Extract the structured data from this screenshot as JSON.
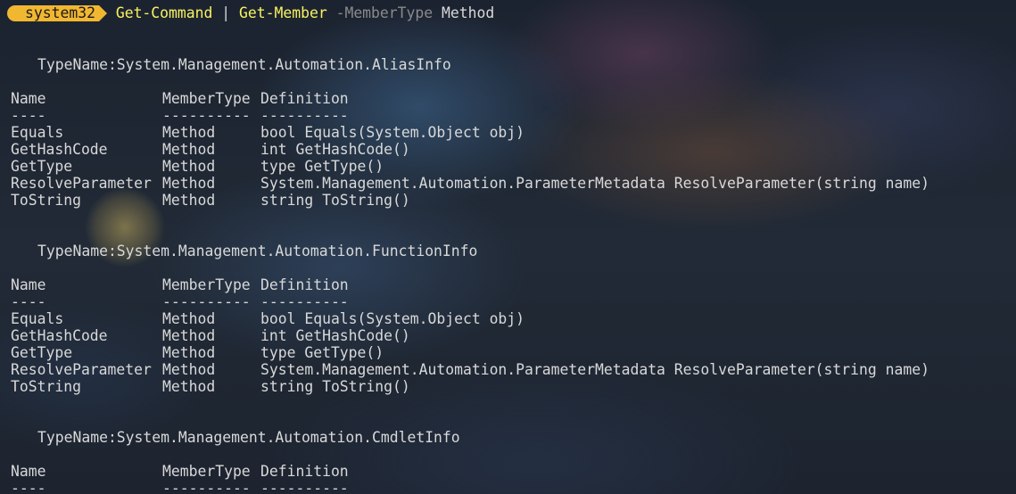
{
  "prompt": {
    "directory": "system32",
    "command1": "Get-Command",
    "pipe": "|",
    "command2": "Get-Member",
    "parameter": "-MemberType",
    "argument": "Method"
  },
  "columns": {
    "name": "Name",
    "member_type": "MemberType",
    "definition": "Definition",
    "dash_name": "----",
    "dash_member_type": "----------",
    "dash_definition": "----------"
  },
  "sections": [
    {
      "typename": "TypeName:System.Management.Automation.AliasInfo",
      "rows": [
        {
          "name": "Equals",
          "member_type": "Method",
          "definition": "bool Equals(System.Object obj)"
        },
        {
          "name": "GetHashCode",
          "member_type": "Method",
          "definition": "int GetHashCode()"
        },
        {
          "name": "GetType",
          "member_type": "Method",
          "definition": "type GetType()"
        },
        {
          "name": "ResolveParameter",
          "member_type": "Method",
          "definition": "System.Management.Automation.ParameterMetadata ResolveParameter(string name)"
        },
        {
          "name": "ToString",
          "member_type": "Method",
          "definition": "string ToString()"
        }
      ]
    },
    {
      "typename": "TypeName:System.Management.Automation.FunctionInfo",
      "rows": [
        {
          "name": "Equals",
          "member_type": "Method",
          "definition": "bool Equals(System.Object obj)"
        },
        {
          "name": "GetHashCode",
          "member_type": "Method",
          "definition": "int GetHashCode()"
        },
        {
          "name": "GetType",
          "member_type": "Method",
          "definition": "type GetType()"
        },
        {
          "name": "ResolveParameter",
          "member_type": "Method",
          "definition": "System.Management.Automation.ParameterMetadata ResolveParameter(string name)"
        },
        {
          "name": "ToString",
          "member_type": "Method",
          "definition": "string ToString()"
        }
      ]
    },
    {
      "typename": "TypeName:System.Management.Automation.CmdletInfo",
      "rows": []
    }
  ]
}
